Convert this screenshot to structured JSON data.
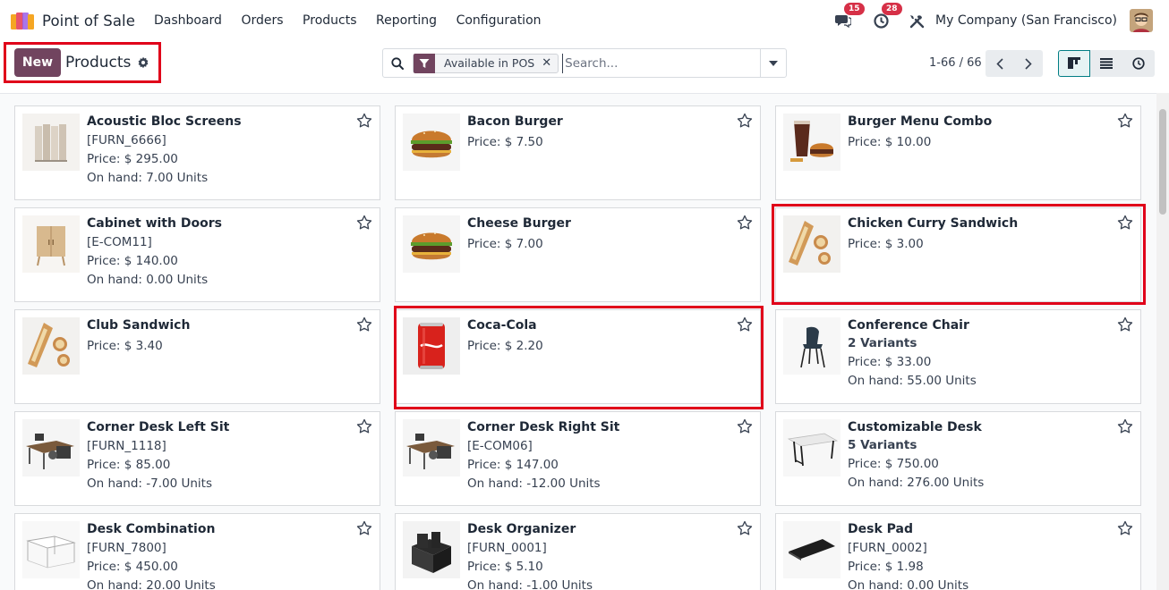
{
  "app": {
    "name": "Point of Sale"
  },
  "menu": [
    "Dashboard",
    "Orders",
    "Products",
    "Reporting",
    "Configuration"
  ],
  "systray": {
    "messages_count": "15",
    "activities_count": "28",
    "company": "My Company (San Francisco)"
  },
  "control": {
    "new_label": "New",
    "title": "Products",
    "facet_label": "Available in POS",
    "search_placeholder": "Search...",
    "pager": "1-66 / 66"
  },
  "colors": {
    "brand": "#71445f",
    "highlight": "#e0001a",
    "accent": "#017e84"
  },
  "products": [
    {
      "name": "Acoustic Bloc Screens",
      "code": "[FURN_6666]",
      "price": "Price: $ 295.00",
      "onhand": "On hand: 7.00 Units",
      "image": "screens"
    },
    {
      "name": "Bacon Burger",
      "price": "Price: $ 7.50",
      "image": "burger"
    },
    {
      "name": "Burger Menu Combo",
      "price": "Price: $ 10.00",
      "image": "combo"
    },
    {
      "name": "Cabinet with Doors",
      "code": "[E-COM11]",
      "price": "Price: $ 140.00",
      "onhand": "On hand: 0.00 Units",
      "image": "cabinet"
    },
    {
      "name": "Cheese Burger",
      "price": "Price: $ 7.00",
      "image": "burger"
    },
    {
      "name": "Chicken Curry Sandwich",
      "price": "Price: $ 3.00",
      "image": "sandwich"
    },
    {
      "name": "Club Sandwich",
      "price": "Price: $ 3.40",
      "image": "sandwich"
    },
    {
      "name": "Coca-Cola",
      "price": "Price: $ 2.20",
      "image": "can"
    },
    {
      "name": "Conference Chair",
      "variants": "2 Variants",
      "price": "Price: $ 33.00",
      "onhand": "On hand: 55.00 Units",
      "image": "chair"
    },
    {
      "name": "Corner Desk Left Sit",
      "code": "[FURN_1118]",
      "price": "Price: $ 85.00",
      "onhand": "On hand: -7.00 Units",
      "image": "desk-corner"
    },
    {
      "name": "Corner Desk Right Sit",
      "code": "[E-COM06]",
      "price": "Price: $ 147.00",
      "onhand": "On hand: -12.00 Units",
      "image": "desk-corner"
    },
    {
      "name": "Customizable Desk",
      "variants": "5 Variants",
      "price": "Price: $ 750.00",
      "onhand": "On hand: 276.00 Units",
      "image": "desk-white"
    },
    {
      "name": "Desk Combination",
      "code": "[FURN_7800]",
      "price": "Price: $ 450.00",
      "onhand": "On hand: 20.00 Units",
      "image": "desk-combo"
    },
    {
      "name": "Desk Organizer",
      "code": "[FURN_0001]",
      "price": "Price: $ 5.10",
      "onhand": "On hand: -1.00 Units",
      "image": "organizer"
    },
    {
      "name": "Desk Pad",
      "code": "[FURN_0002]",
      "price": "Price: $ 1.98",
      "onhand": "On hand: 0.00 Units",
      "image": "deskpad"
    }
  ]
}
